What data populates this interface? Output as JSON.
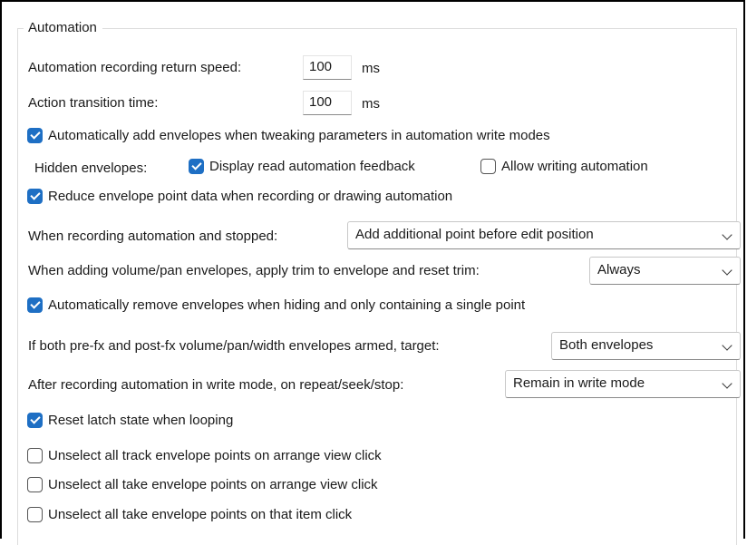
{
  "automation": {
    "group_title": "Automation",
    "return_speed": {
      "label": "Automation recording return speed:",
      "value": "100",
      "unit": "ms"
    },
    "transition_time": {
      "label": "Action transition time:",
      "value": "100",
      "unit": "ms"
    },
    "auto_add_envelopes": {
      "label": "Automatically add envelopes when tweaking parameters in automation write modes",
      "checked": true
    },
    "hidden_envelopes": {
      "label": "Hidden envelopes:",
      "display_feedback": {
        "label": "Display read automation feedback",
        "checked": true
      },
      "allow_writing": {
        "label": "Allow writing automation",
        "checked": false
      }
    },
    "reduce_point_data": {
      "label": "Reduce envelope point data when recording or drawing automation",
      "checked": true
    },
    "recording_stopped": {
      "label": "When recording automation and stopped:",
      "selected": "Add additional point before edit position"
    },
    "apply_trim": {
      "label": "When adding volume/pan envelopes, apply trim to envelope and reset trim:",
      "selected": "Always"
    },
    "auto_remove_envelopes": {
      "label": "Automatically remove envelopes when hiding and only containing a single point",
      "checked": true
    },
    "prefx_postfx_target": {
      "label": "If both pre-fx and post-fx volume/pan/width envelopes armed, target:",
      "selected": "Both envelopes"
    },
    "after_recording": {
      "label": "After recording automation in write mode, on repeat/seek/stop:",
      "selected": "Remain in write mode"
    },
    "reset_latch": {
      "label": "Reset latch state when looping",
      "checked": true
    },
    "unselect_track_points": {
      "label": "Unselect all track envelope points on arrange view click",
      "checked": false
    },
    "unselect_take_points": {
      "label": "Unselect all take envelope points on arrange view click",
      "checked": false
    },
    "unselect_take_points_item": {
      "label": "Unselect all take envelope points on that item click",
      "checked": false
    }
  }
}
